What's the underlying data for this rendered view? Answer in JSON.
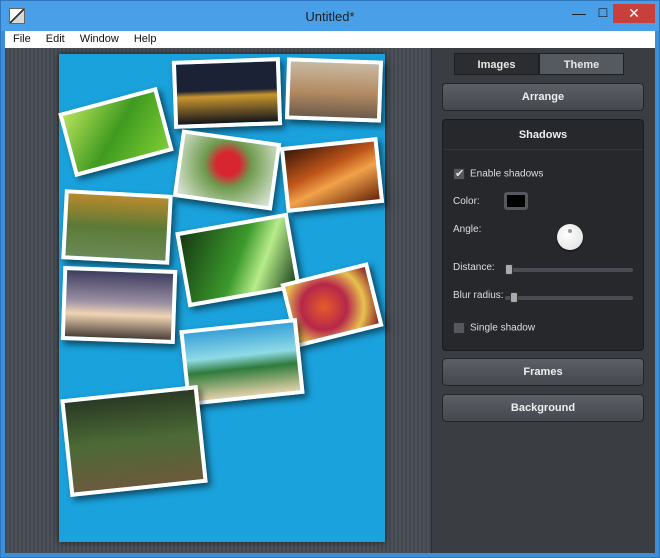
{
  "window": {
    "title": "Untitled*",
    "controls": {
      "minimize": "—",
      "maximize": "☐",
      "close": "✕"
    }
  },
  "menu": {
    "items": [
      "File",
      "Edit",
      "Window",
      "Help"
    ]
  },
  "canvas": {
    "background": "#1aa2dd",
    "photos": [
      {
        "name": "photo-leaf",
        "bg": "linear-gradient(135deg,#b6e25a,#3f9a1f 50%,#7ccc33)"
      },
      {
        "name": "photo-night-harbor",
        "bg": "linear-gradient(#1b2236 0 45%,#c8962e 55%,#14161c)"
      },
      {
        "name": "photo-cathedral",
        "bg": "linear-gradient(#c9b9a0,#b38a62 55%,#6d5c4a)"
      },
      {
        "name": "photo-berries",
        "bg": "radial-gradient(circle at 50% 40%,#d82631 0 20%,#6e9a4e 40%,#dfe9d8)"
      },
      {
        "name": "photo-canyon",
        "bg": "linear-gradient(160deg,#3c1708,#c0561a 40%,#f2a24a 60%,#6a250a)"
      },
      {
        "name": "photo-autumn-park",
        "bg": "linear-gradient(#b98a2c,#5c7a36 50%,#6b8a56)"
      },
      {
        "name": "photo-bottles",
        "bg": "linear-gradient(120deg,#163a12,#3c9a2c 50%,#b8ec8a 70%,#18401a)"
      },
      {
        "name": "photo-sunset-sky",
        "bg": "linear-gradient(#3f3d5f,#9a8fa3 45%,#f0d4b4 65%,#4a3f38)"
      },
      {
        "name": "photo-peppers",
        "bg": "radial-gradient(circle at 40% 50%,#e65b2a,#b6274a 40%,#e8c250 70%,#8a1c24)"
      },
      {
        "name": "photo-beach-palms",
        "bg": "linear-gradient(#3aa1d8,#8fdbe6 40%,#2f7b3b 60%,#e2d1a8)"
      },
      {
        "name": "photo-eagle",
        "bg": "linear-gradient(#2a3a24,#4c6a36 50%,#6b5a3c)"
      }
    ]
  },
  "panel": {
    "tabs": [
      {
        "label": "Images",
        "active": false
      },
      {
        "label": "Theme",
        "active": true
      }
    ],
    "arrange_label": "Arrange",
    "shadows": {
      "title": "Shadows",
      "enable_label": "Enable shadows",
      "enable_checked": true,
      "color_label": "Color:",
      "color_value": "#000000",
      "angle_label": "Angle:",
      "distance_label": "Distance:",
      "distance_value": 0.0,
      "blur_label": "Blur radius:",
      "blur_value": 0.04,
      "single_label": "Single shadow",
      "single_checked": false
    },
    "frames_label": "Frames",
    "background_label": "Background"
  }
}
